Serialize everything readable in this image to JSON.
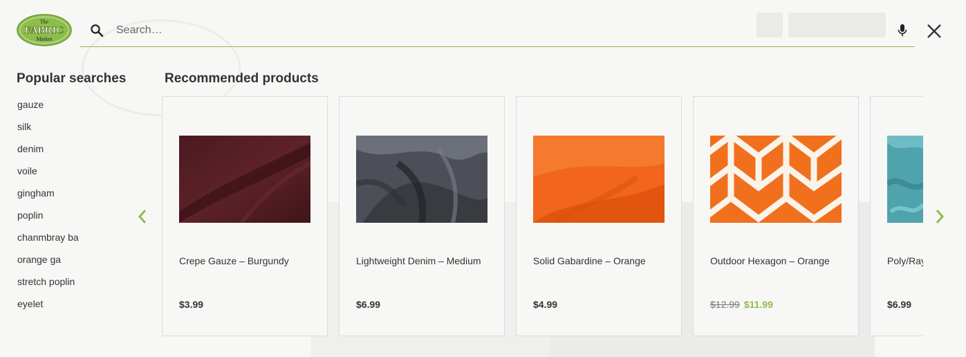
{
  "header": {
    "logo_text": [
      "The",
      "FABRIC",
      "Market"
    ],
    "search_placeholder": "Search…",
    "accent_color": "#8dbd4a"
  },
  "popular": {
    "title": "Popular searches",
    "items": [
      "gauze",
      "silk",
      "denim",
      "voile",
      "gingham",
      "poplin",
      "chanmbray ba",
      "orange ga",
      "stretch poplin",
      "eyelet"
    ]
  },
  "recommended": {
    "title": "Recommended products",
    "products": [
      {
        "name": "Crepe Gauze – Burgundy",
        "price": "$3.99",
        "image": "burgundy-fabric"
      },
      {
        "name": "Lightweight Denim – Medium",
        "price": "$6.99",
        "image": "grey-denim-fabric"
      },
      {
        "name": "Solid Gabardine – Orange",
        "price": "$4.99",
        "image": "orange-fabric"
      },
      {
        "name": "Outdoor Hexagon – Orange",
        "old_price": "$12.99",
        "price": "$11.99",
        "image": "orange-white-pattern-fabric"
      },
      {
        "name": "Poly/Rayon Light Turquoise",
        "price": "$6.99",
        "image": "turquoise-fabric"
      }
    ]
  },
  "icons": {
    "search": "search-icon",
    "mic": "mic-icon",
    "close": "close-icon",
    "prev": "chevron-left-icon",
    "next": "chevron-right-icon"
  }
}
